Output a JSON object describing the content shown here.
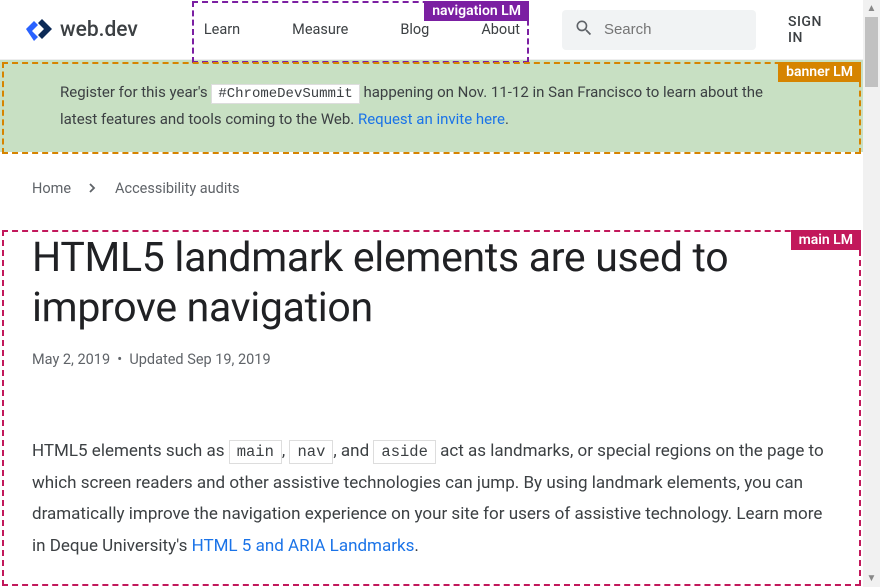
{
  "header": {
    "logo_text": "web.dev",
    "nav": [
      "Learn",
      "Measure",
      "Blog",
      "About"
    ],
    "search_placeholder": "Search",
    "signin": "SIGN IN"
  },
  "landmarks": {
    "nav": "navigation LM",
    "banner": "banner LM",
    "main": "main LM"
  },
  "banner": {
    "pre": "Register for this year's ",
    "hashtag": "#ChromeDevSummit",
    "mid": " happening on Nov. 11-12 in San Francisco to learn about the latest features and tools coming to the Web. ",
    "link": "Request an invite here",
    "post": "."
  },
  "breadcrumb": {
    "home": "Home",
    "current": "Accessibility audits"
  },
  "article": {
    "title": "HTML5 landmark elements are used to improve navigation",
    "date_published": "May 2, 2019",
    "date_updated_label": "Updated",
    "date_updated": "Sep 19, 2019",
    "p1_a": "HTML5 elements such as ",
    "code1": "main",
    "p1_b": ", ",
    "code2": "nav",
    "p1_c": ", and ",
    "code3": "aside",
    "p1_d": " act as landmarks, or special regions on the page to which screen readers and other assistive technologies can jump. By using landmark elements, you can dramatically improve the navigation experience on your site for users of assistive technology. Learn more in Deque University's ",
    "link1": "HTML 5 and ARIA Landmarks",
    "p1_e": "."
  }
}
